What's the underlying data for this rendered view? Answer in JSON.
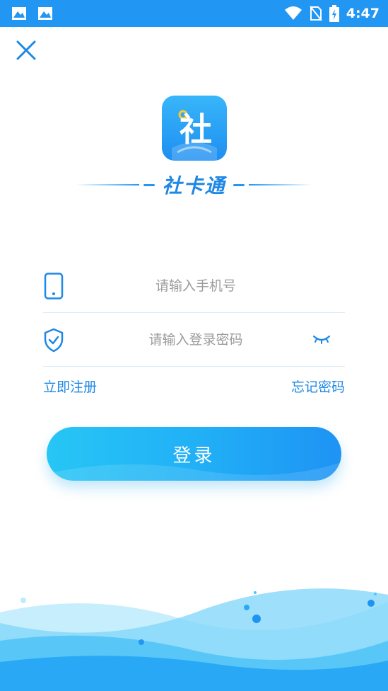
{
  "status_bar": {
    "time": "4:47",
    "icons": [
      "image-notification-icon",
      "image-notification-icon",
      "wifi-icon",
      "no-sim-icon",
      "battery-charging-icon"
    ]
  },
  "close": {
    "icon": "close-icon"
  },
  "logo": {
    "glyph": "社",
    "icon": "app-logo"
  },
  "brand": {
    "name": "社卡通"
  },
  "phone": {
    "icon": "phone-icon",
    "placeholder": "请输入手机号",
    "value": ""
  },
  "password": {
    "icon": "shield-icon",
    "placeholder": "请输入登录密码",
    "value": "",
    "toggle_icon": "eye-closed-icon"
  },
  "links": {
    "register": "立即注册",
    "forgot": "忘记密码"
  },
  "login": {
    "label": "登录"
  },
  "colors": {
    "primary": "#2196F3",
    "link": "#1E88E5",
    "button_start": "#27C6F5",
    "button_end": "#1E93F4"
  }
}
